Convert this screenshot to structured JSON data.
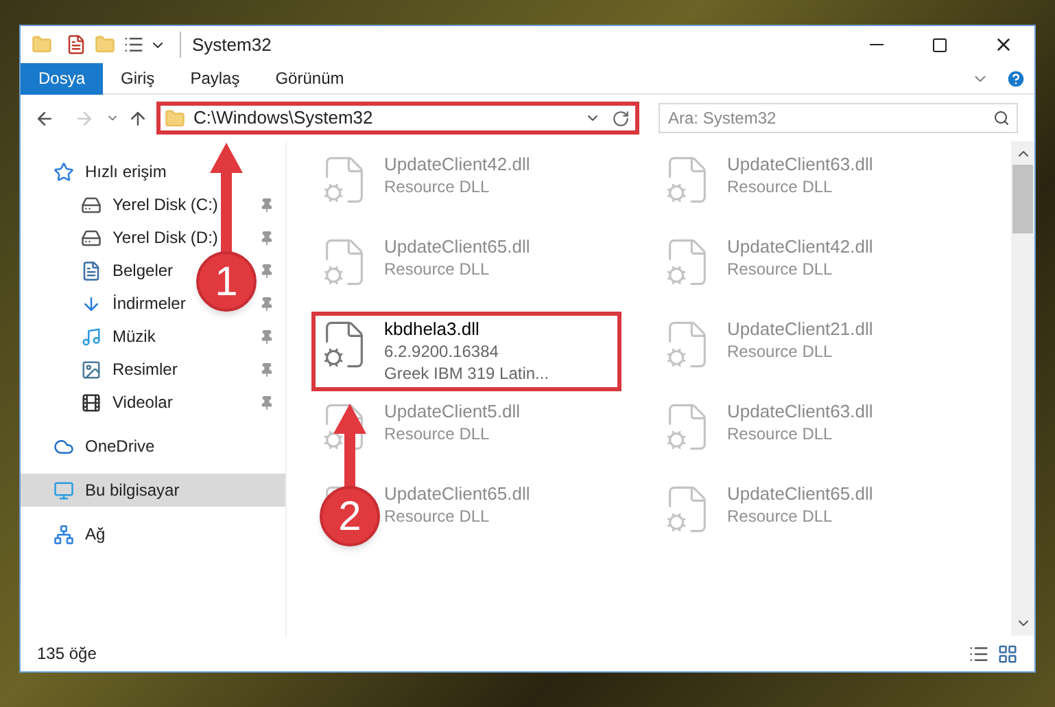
{
  "window": {
    "title": "System32"
  },
  "ribbon_tabs": [
    {
      "label": "Dosya",
      "selected": true
    },
    {
      "label": "Giriş",
      "selected": false
    },
    {
      "label": "Paylaş",
      "selected": false
    },
    {
      "label": "Görünüm",
      "selected": false
    }
  ],
  "address_bar": {
    "path": "C:\\Windows\\System32",
    "highlighted": true
  },
  "search": {
    "placeholder": "Ara: System32"
  },
  "sidebar": [
    {
      "label": "Hızlı erişim",
      "selected": false,
      "children": [
        {
          "label": "Yerel Disk (C:)",
          "pinned": true
        },
        {
          "label": "Yerel Disk (D:)",
          "pinned": true
        },
        {
          "label": "Belgeler",
          "pinned": true
        },
        {
          "label": "İndirmeler",
          "pinned": true
        },
        {
          "label": "Müzik",
          "pinned": true
        },
        {
          "label": "Resimler",
          "pinned": true
        },
        {
          "label": "Videolar",
          "pinned": true
        }
      ]
    },
    {
      "label": "OneDrive",
      "selected": false
    },
    {
      "label": "Bu bilgisayar",
      "selected": true
    },
    {
      "label": "Ağ",
      "selected": false
    }
  ],
  "files": [
    {
      "name": "UpdateClient42.dll",
      "details": [
        "Resource DLL"
      ],
      "dimmed": true,
      "highlighted": false
    },
    {
      "name": "UpdateClient63.dll",
      "details": [
        "Resource DLL"
      ],
      "dimmed": true,
      "highlighted": false
    },
    {
      "name": "UpdateClient65.dll",
      "details": [
        "Resource DLL"
      ],
      "dimmed": true,
      "highlighted": false
    },
    {
      "name": "UpdateClient42.dll",
      "details": [
        "Resource DLL"
      ],
      "dimmed": true,
      "highlighted": false
    },
    {
      "name": "kbdhela3.dll",
      "details": [
        "6.2.9200.16384",
        "Greek IBM 319 Latin..."
      ],
      "dimmed": false,
      "highlighted": true
    },
    {
      "name": "UpdateClient21.dll",
      "details": [
        "Resource DLL"
      ],
      "dimmed": true,
      "highlighted": false
    },
    {
      "name": "UpdateClient5.dll",
      "details": [
        "Resource DLL"
      ],
      "dimmed": true,
      "highlighted": false
    },
    {
      "name": "UpdateClient63.dll",
      "details": [
        "Resource DLL"
      ],
      "dimmed": true,
      "highlighted": false
    },
    {
      "name": "UpdateClient65.dll",
      "details": [
        "Resource DLL"
      ],
      "dimmed": true,
      "highlighted": false
    },
    {
      "name": "UpdateClient65.dll",
      "details": [
        "Resource DLL"
      ],
      "dimmed": true,
      "highlighted": false
    }
  ],
  "status_bar": {
    "count": "135 öğe"
  },
  "annotations": [
    {
      "number": "1"
    },
    {
      "number": "2"
    }
  ]
}
